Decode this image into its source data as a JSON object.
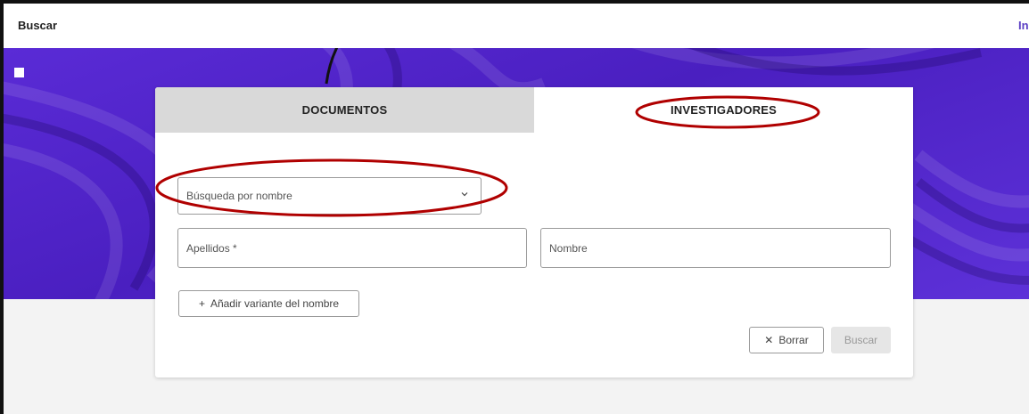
{
  "header": {
    "title": "Buscar",
    "right_link": "In"
  },
  "tabs": [
    {
      "label": "DOCUMENTOS"
    },
    {
      "label": "INVESTIGADORES"
    }
  ],
  "form": {
    "search_type": {
      "value": "Búsqueda por nombre",
      "icon": "chevron-down-icon"
    },
    "surname": {
      "label": "Apellidos *"
    },
    "name": {
      "label": "Nombre"
    },
    "add_variant_label": "Añadir variante del nombre",
    "clear_label": "Borrar",
    "search_label": "Buscar"
  },
  "colors": {
    "hero": "#4a1fc0",
    "annotation": "#b00000",
    "link": "#5b3fc4"
  }
}
